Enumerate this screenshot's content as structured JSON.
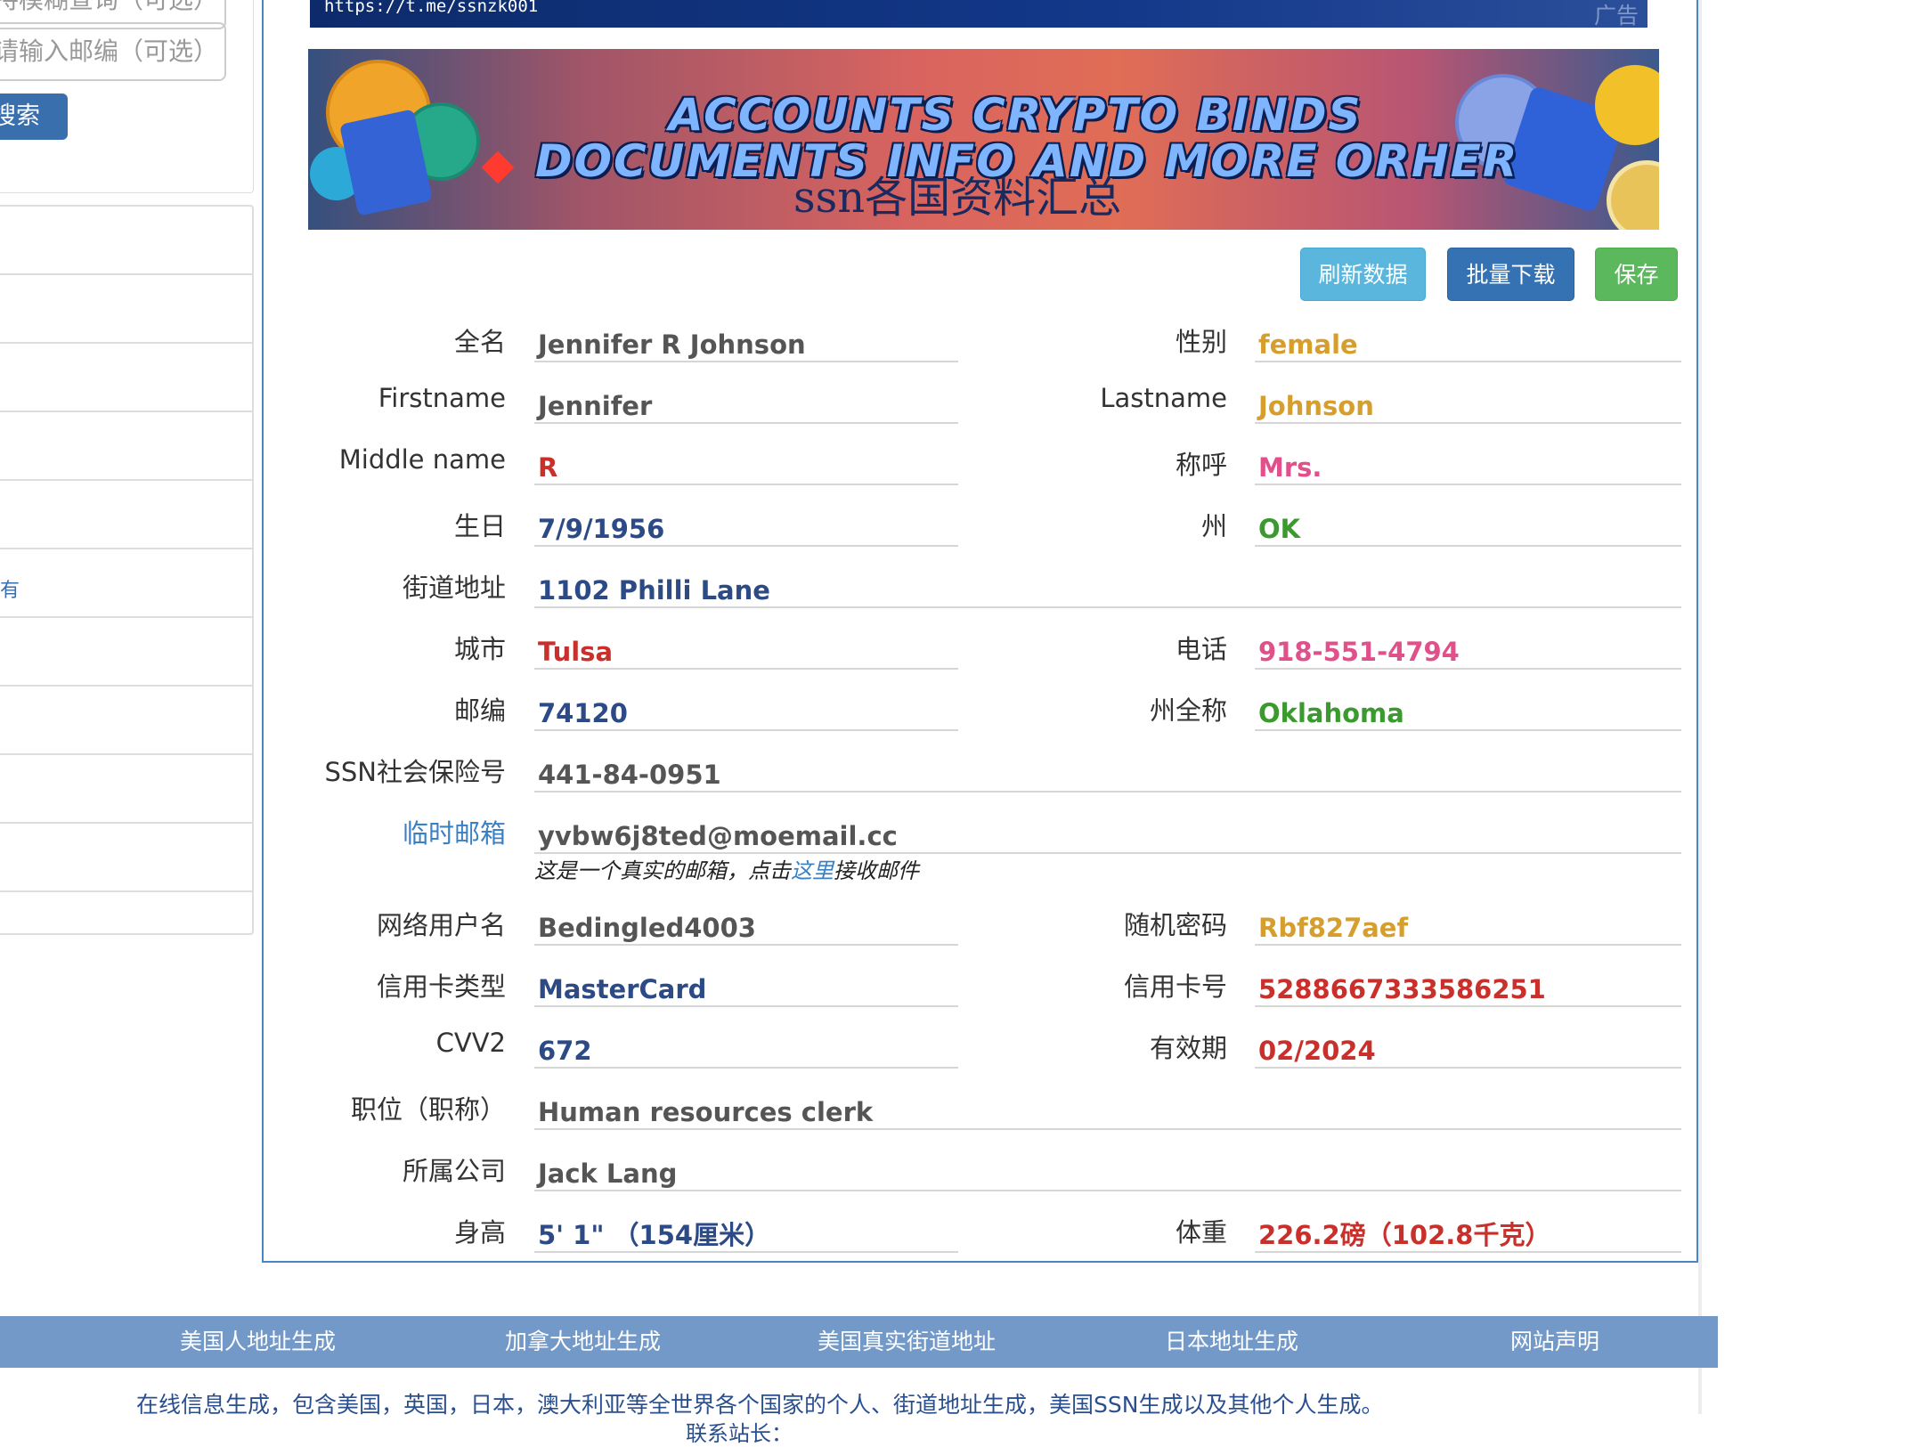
{
  "sidebar": {
    "input_partial_label": "持模糊查询（可选）",
    "zip_placeholder": "请输入邮编（可选）",
    "search_button": "搜索",
    "list_marker": "有"
  },
  "ad": {
    "url": "https://t.me/ssnzk001",
    "label": "广告"
  },
  "banner": {
    "line1": "ACCOUNTS CRYPTO BINDS",
    "line2": "DOCUMENTS INFO AND MORE ORHER",
    "line3": "ssn各国资料汇总"
  },
  "actions": {
    "refresh": "刷新数据",
    "download": "批量下载",
    "save": "保存"
  },
  "fields": {
    "fullname": {
      "label": "全名",
      "value": "Jennifer R Johnson"
    },
    "gender": {
      "label": "性别",
      "value": "female"
    },
    "firstname": {
      "label": "Firstname",
      "value": "Jennifer"
    },
    "lastname": {
      "label": "Lastname",
      "value": "Johnson"
    },
    "middlename": {
      "label": "Middle name",
      "value": "R"
    },
    "title": {
      "label": "称呼",
      "value": "Mrs."
    },
    "birthday": {
      "label": "生日",
      "value": "7/9/1956"
    },
    "state": {
      "label": "州",
      "value": "OK"
    },
    "street": {
      "label": "街道地址",
      "value": "1102 Philli Lane"
    },
    "city": {
      "label": "城市",
      "value": "Tulsa"
    },
    "phone": {
      "label": "电话",
      "value": "918-551-4794"
    },
    "zip": {
      "label": "邮编",
      "value": "74120"
    },
    "state_full": {
      "label": "州全称",
      "value": "Oklahoma"
    },
    "ssn": {
      "label": "SSN社会保险号",
      "value": "441-84-0951"
    },
    "temp_email": {
      "label": "临时邮箱",
      "value": "yvbw6j8ted@moemail.cc"
    },
    "username": {
      "label": "网络用户名",
      "value": "Bedingled4003"
    },
    "password": {
      "label": "随机密码",
      "value": "Rbf827aef"
    },
    "card_type": {
      "label": "信用卡类型",
      "value": "MasterCard"
    },
    "card_number": {
      "label": "信用卡号",
      "value": "5288667333586251"
    },
    "cvv": {
      "label": "CVV2",
      "value": "672"
    },
    "expiry": {
      "label": "有效期",
      "value": "02/2024"
    },
    "job": {
      "label": "职位（职称）",
      "value": "Human resources clerk"
    },
    "company": {
      "label": "所属公司",
      "value": "Jack Lang"
    },
    "height": {
      "label": "身高",
      "value": "5' 1\" （154厘米）"
    },
    "weight": {
      "label": "体重",
      "value": "226.2磅（102.8千克）"
    }
  },
  "email_note": {
    "before": "这是一个真实的邮箱，点击",
    "link": "这里",
    "after": "接收邮件"
  },
  "footer": {
    "nav": [
      "美国人地址生成",
      "加拿大地址生成",
      "美国真实街道地址",
      "日本地址生成",
      "网站声明"
    ],
    "description": "在线信息生成，包含美国，英国，日本，澳大利亚等全世界各个国家的个人、街道地址生成，美国SSN生成以及其他个人生成。",
    "contact": "联系站长："
  },
  "colors": {
    "panel_border": "#4a86c5",
    "refresh_button": "#5ab6dc",
    "download_button": "#3472b4",
    "save_button": "#5cb85c",
    "footer_bar": "#7299c8"
  }
}
